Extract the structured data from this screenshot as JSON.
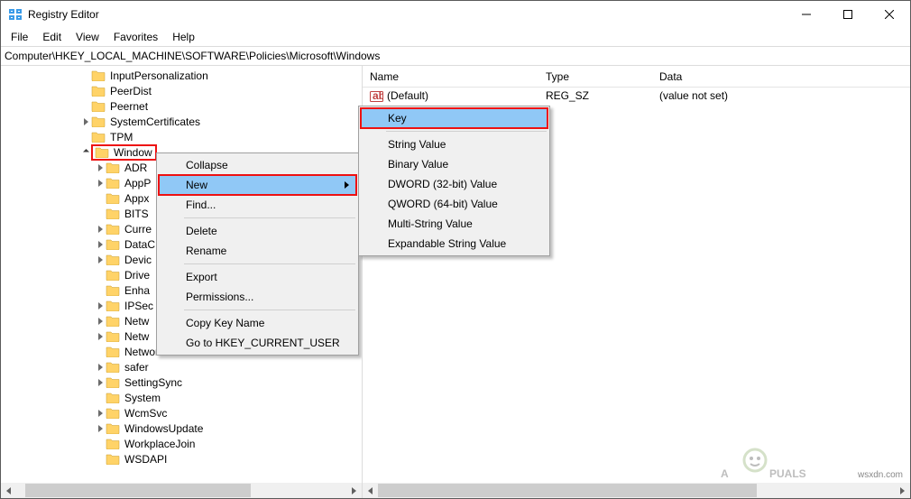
{
  "window": {
    "title": "Registry Editor"
  },
  "menubar": [
    "File",
    "Edit",
    "View",
    "Favorites",
    "Help"
  ],
  "address": "Computer\\HKEY_LOCAL_MACHINE\\SOFTWARE\\Policies\\Microsoft\\Windows",
  "tree": [
    {
      "indent": 88,
      "expander": "",
      "label": "InputPersonalization"
    },
    {
      "indent": 88,
      "expander": "",
      "label": "PeerDist"
    },
    {
      "indent": 88,
      "expander": "",
      "label": "Peernet"
    },
    {
      "indent": 88,
      "expander": "closed",
      "label": "SystemCertificates"
    },
    {
      "indent": 88,
      "expander": "",
      "label": "TPM"
    },
    {
      "indent": 88,
      "expander": "open",
      "label": "Window",
      "selected": true
    },
    {
      "indent": 104,
      "expander": "closed",
      "label": "ADR"
    },
    {
      "indent": 104,
      "expander": "closed",
      "label": "AppP"
    },
    {
      "indent": 104,
      "expander": "",
      "label": "Appx"
    },
    {
      "indent": 104,
      "expander": "",
      "label": "BITS"
    },
    {
      "indent": 104,
      "expander": "closed",
      "label": "Curre"
    },
    {
      "indent": 104,
      "expander": "closed",
      "label": "DataC"
    },
    {
      "indent": 104,
      "expander": "closed",
      "label": "Devic"
    },
    {
      "indent": 104,
      "expander": "",
      "label": "Drive"
    },
    {
      "indent": 104,
      "expander": "",
      "label": "Enha"
    },
    {
      "indent": 104,
      "expander": "closed",
      "label": "IPSec"
    },
    {
      "indent": 104,
      "expander": "closed",
      "label": "Netw"
    },
    {
      "indent": 104,
      "expander": "closed",
      "label": "Netw"
    },
    {
      "indent": 104,
      "expander": "",
      "label": "NetworkProvider"
    },
    {
      "indent": 104,
      "expander": "closed",
      "label": "safer"
    },
    {
      "indent": 104,
      "expander": "closed",
      "label": "SettingSync"
    },
    {
      "indent": 104,
      "expander": "",
      "label": "System"
    },
    {
      "indent": 104,
      "expander": "closed",
      "label": "WcmSvc"
    },
    {
      "indent": 104,
      "expander": "closed",
      "label": "WindowsUpdate"
    },
    {
      "indent": 104,
      "expander": "",
      "label": "WorkplaceJoin"
    },
    {
      "indent": 104,
      "expander": "",
      "label": "WSDAPI"
    }
  ],
  "list": {
    "headers": {
      "name": "Name",
      "type": "Type",
      "data": "Data"
    },
    "rows": [
      {
        "name": "(Default)",
        "type": "REG_SZ",
        "data": "(value not set)"
      }
    ]
  },
  "context_menu": {
    "items": [
      {
        "label": "Collapse"
      },
      {
        "label": "New",
        "highlight": true,
        "boxed": true,
        "submenu": true
      },
      {
        "label": "Find..."
      },
      {
        "sep": true
      },
      {
        "label": "Delete"
      },
      {
        "label": "Rename"
      },
      {
        "sep": true
      },
      {
        "label": "Export"
      },
      {
        "label": "Permissions..."
      },
      {
        "sep": true
      },
      {
        "label": "Copy Key Name"
      },
      {
        "label": "Go to HKEY_CURRENT_USER"
      }
    ],
    "submenu": [
      {
        "label": "Key",
        "highlight": true,
        "boxed": true
      },
      {
        "sep": true
      },
      {
        "label": "String Value"
      },
      {
        "label": "Binary Value"
      },
      {
        "label": "DWORD (32-bit) Value"
      },
      {
        "label": "QWORD (64-bit) Value"
      },
      {
        "label": "Multi-String Value"
      },
      {
        "label": "Expandable String Value"
      }
    ]
  },
  "watermark": "wsxdn.com"
}
